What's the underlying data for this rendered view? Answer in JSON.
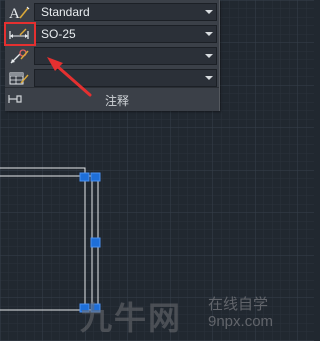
{
  "annotation_panel": {
    "title": "注释",
    "text_style": {
      "value": "Standard",
      "icon": "text-style-icon"
    },
    "dim_style": {
      "value": "SO-25",
      "icon": "dimension-style-icon"
    },
    "multileader_style": {
      "value": "",
      "icon": "multileader-style-icon"
    },
    "table_style": {
      "value": "",
      "icon": "table-style-icon"
    }
  },
  "colors": {
    "canvas": "#212830",
    "panel": "#3b4048",
    "highlight": "#e53030",
    "grip": "#1e6fd9"
  },
  "watermark": {
    "brand": "九牛网",
    "slogan": "在线自学",
    "url": "9npx.com"
  }
}
